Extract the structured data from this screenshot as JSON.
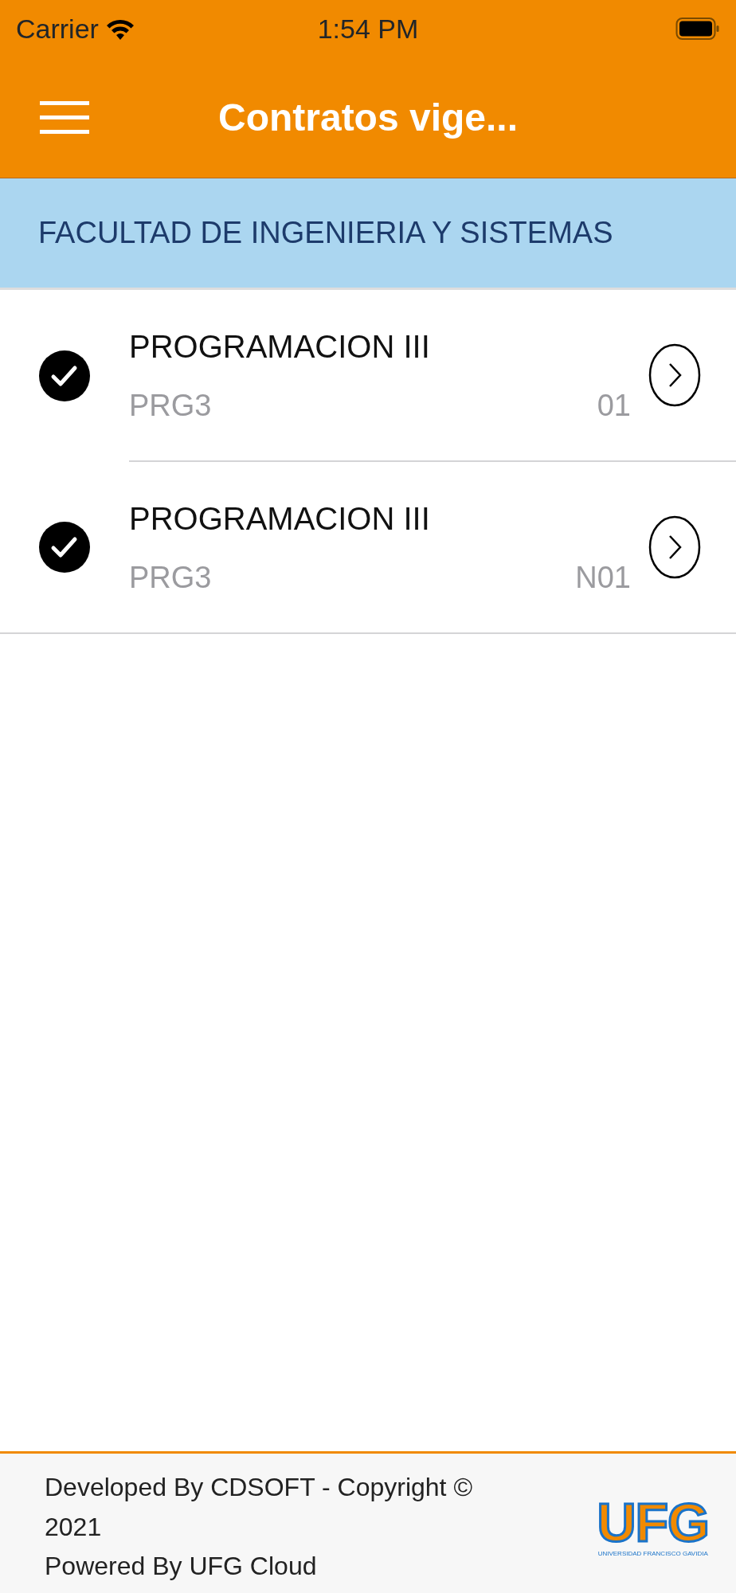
{
  "status_bar": {
    "carrier": "Carrier",
    "time": "1:54 PM"
  },
  "nav_bar": {
    "title": "Contratos vige..."
  },
  "section": {
    "title": "FACULTAD DE INGENIERIA Y SISTEMAS"
  },
  "courses": [
    {
      "name": "PROGRAMACION III",
      "code": "PRG3",
      "group": "01",
      "checked": true
    },
    {
      "name": "PROGRAMACION III",
      "code": "PRG3",
      "group": "N01",
      "checked": true
    }
  ],
  "footer": {
    "lines": [
      "Developed By CDSOFT - Copyright © 2021",
      "Powered By UFG Cloud"
    ],
    "logo": {
      "mark": "UFG",
      "caption": "UNIVERSIDAD FRANCISCO GAVIDIA"
    }
  }
}
